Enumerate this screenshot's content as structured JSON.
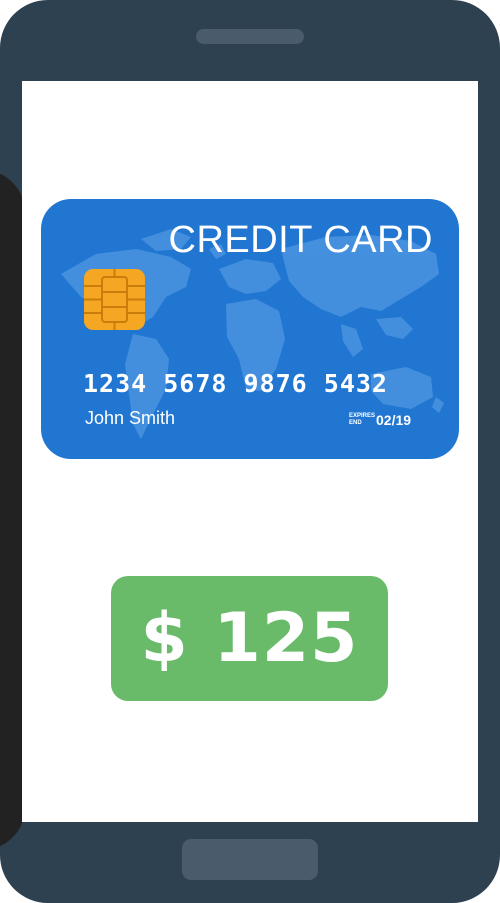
{
  "card": {
    "title": "CREDIT CARD",
    "number": "1234 5678 9876 5432",
    "holder": "John Smith",
    "expiry_label_line1": "EXPIRES",
    "expiry_label_line2": "END",
    "expiry": "02/19"
  },
  "payment": {
    "amount": "$ 125"
  },
  "colors": {
    "phone_body": "#2e4150",
    "phone_details": "#4a5c6b",
    "screen": "#ffffff",
    "card": "#2176d2",
    "card_map": "#4a94e0",
    "chip": "#f5a623",
    "amount_badge": "#69bb6a"
  },
  "icons": {
    "chip": "chip-icon",
    "map": "world-map-icon"
  }
}
